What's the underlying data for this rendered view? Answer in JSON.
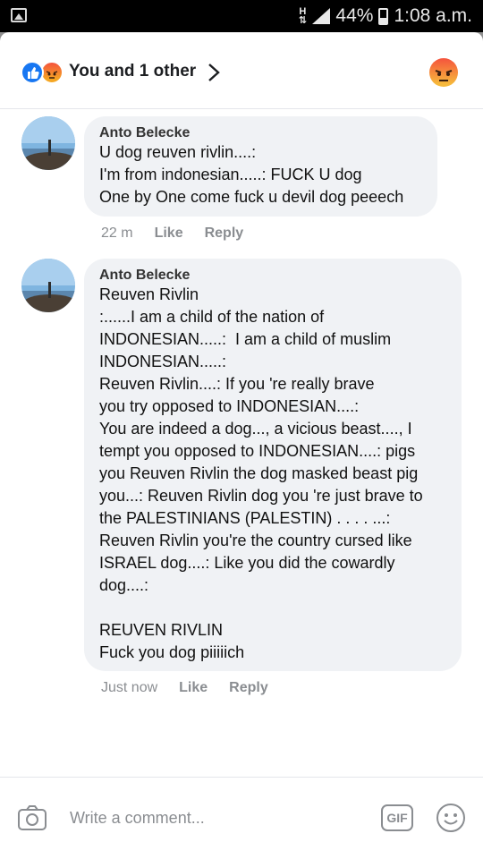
{
  "status_bar": {
    "network_type": "H",
    "battery_percent": "44%",
    "time": "1:08 a.m."
  },
  "reactions": {
    "summary": "You and 1 other",
    "icons": [
      "like-icon",
      "angry-icon"
    ]
  },
  "comments": [
    {
      "author": "Anto Belecke",
      "text": "U dog reuven rivlin....:\nI'm from indonesian.....: FUCK U dog\nOne by One come fuck u devil dog peeech",
      "time": "22 m",
      "like_label": "Like",
      "reply_label": "Reply"
    },
    {
      "author": "Anto Belecke",
      "text": "Reuven Rivlin\n:......I am a child of the nation of\nINDONESIAN.....:  I am a child of muslim\nINDONESIAN.....:\nReuven Rivlin....: If you 're really brave\nyou try opposed to INDONESIAN....:\nYou are indeed a dog..., a vicious beast...., I\ntempt you opposed to INDONESIAN....: pigs\nyou Reuven Rivlin the dog masked beast pig\nyou...: Reuven Rivlin dog you 're just brave to\nthe PALESTINIANS (PALESTIN) . . . . ...:\nReuven Rivlin you're the country cursed like\nISRAEL dog....: Like you did the cowardly\ndog....:\n\nREUVEN RIVLIN\nFuck you dog piiiiich",
      "time": "Just now",
      "like_label": "Like",
      "reply_label": "Reply"
    }
  ],
  "composer": {
    "placeholder": "Write a comment...",
    "gif_label": "GIF"
  }
}
